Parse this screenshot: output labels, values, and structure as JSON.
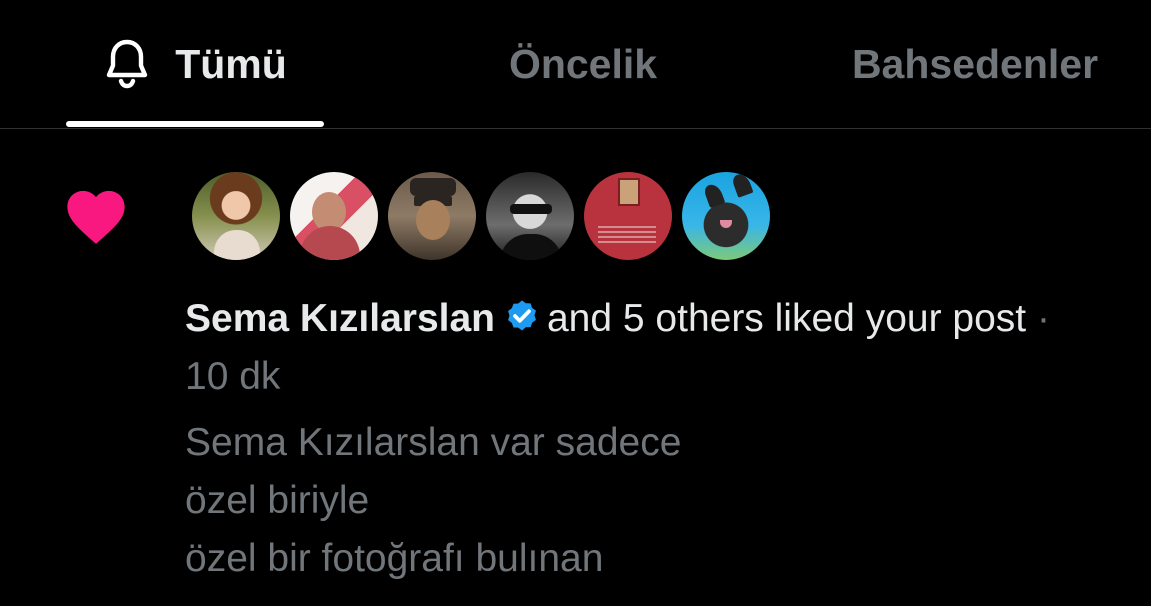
{
  "tabs": [
    {
      "label": "Tümü",
      "active": true,
      "icon": "bell-icon"
    },
    {
      "label": "Öncelik",
      "active": false
    },
    {
      "label": "Bahsedenler",
      "active": false
    }
  ],
  "notification": {
    "type_icon": "heart-icon",
    "type_color": "#f91880",
    "avatars": [
      "avatar-1",
      "avatar-2",
      "avatar-3",
      "avatar-4",
      "avatar-5",
      "avatar-6"
    ],
    "actor_name": "Sema Kızılarslan",
    "verified": true,
    "verified_color": "#1d9bf0",
    "action_text": "and 5 others liked your post",
    "separator": " · ",
    "time": "10 dk",
    "snippet_lines": [
      "Sema Kızılarslan var sadece",
      "özel biriyle",
      "özel bir fotoğrafı bulınan"
    ]
  }
}
